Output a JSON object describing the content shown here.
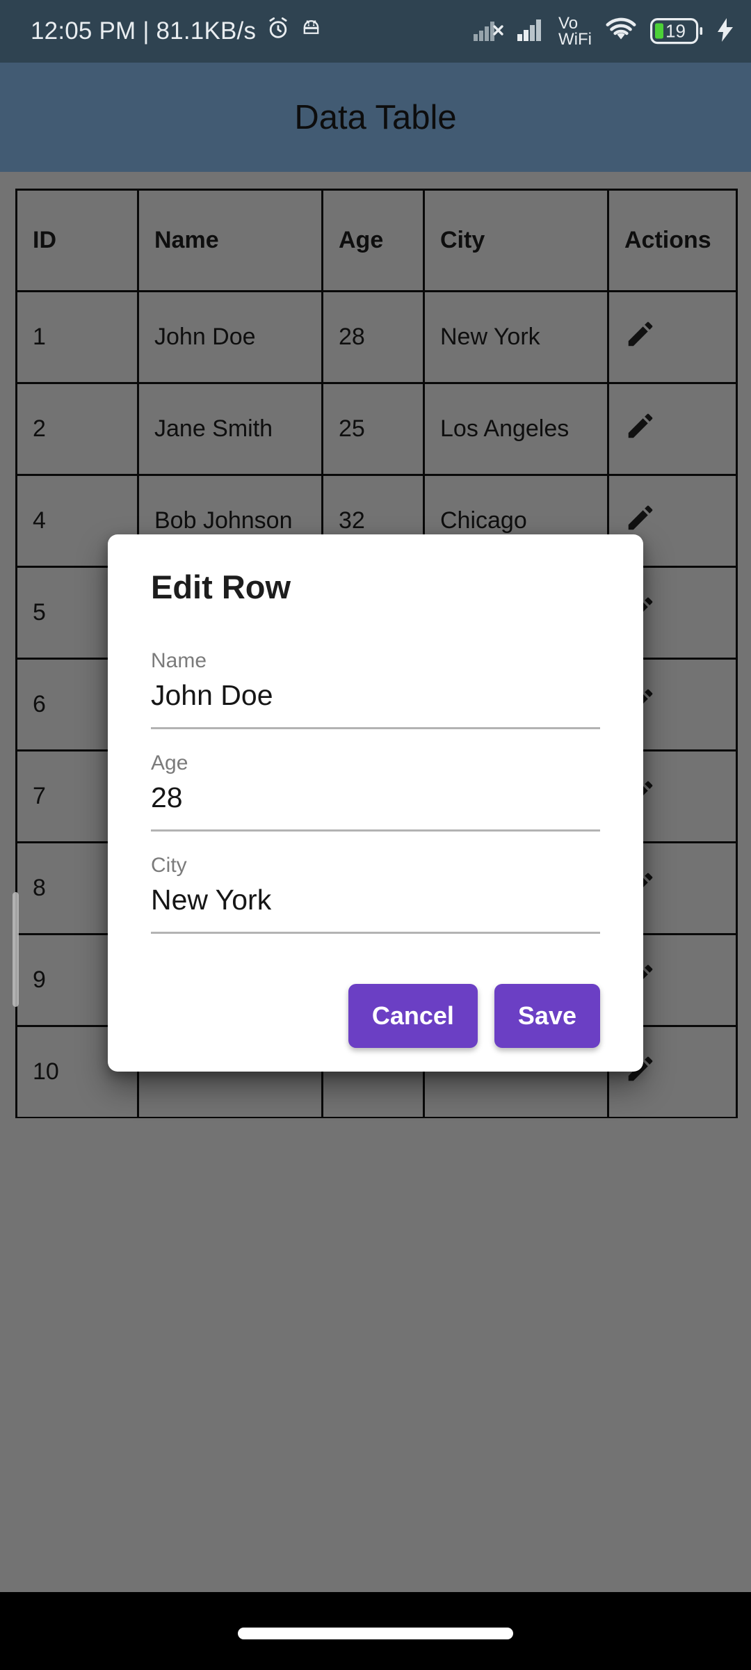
{
  "status_bar": {
    "time_and_net": "12:05 PM | 81.1KB/s",
    "alarm_icon": "alarm-icon",
    "android_debug_icon": "android-head-icon",
    "sim1_icon": "signal-no-service-icon",
    "sim2_icon": "signal-bars-icon",
    "vowifi_line1": "Vo",
    "vowifi_line2": "WiFi",
    "wifi_icon": "wifi-icon",
    "battery_level": "19",
    "charging_icon": "charging-bolt-icon",
    "bg_color": "#2f4351"
  },
  "app_bar": {
    "title": "Data Table",
    "bg_color": "#425b73",
    "title_color": "#0d0d0d"
  },
  "table": {
    "columns": [
      "ID",
      "Name",
      "Age",
      "City",
      "Actions"
    ],
    "action_icon": "pencil-edit-icon",
    "rows": [
      {
        "id": "1",
        "name": "John Doe",
        "age": "28",
        "city": "New York"
      },
      {
        "id": "2",
        "name": "Jane Smith",
        "age": "25",
        "city": "Los Angeles"
      },
      {
        "id": "4",
        "name": "Bob Johnson",
        "age": "32",
        "city": "Chicago"
      },
      {
        "id": "5",
        "name": "",
        "age": "",
        "city": ""
      },
      {
        "id": "6",
        "name": "",
        "age": "",
        "city": ""
      },
      {
        "id": "7",
        "name": "",
        "age": "",
        "city": ""
      },
      {
        "id": "8",
        "name": "",
        "age": "",
        "city": ""
      },
      {
        "id": "9",
        "name": "",
        "age": "",
        "city": ""
      },
      {
        "id": "10",
        "name": "",
        "age": "",
        "city": ""
      }
    ]
  },
  "dialog": {
    "title": "Edit Row",
    "fields": [
      {
        "label": "Name",
        "value": "John Doe"
      },
      {
        "label": "Age",
        "value": "28"
      },
      {
        "label": "City",
        "value": "New York"
      }
    ],
    "cancel_label": "Cancel",
    "save_label": "Save",
    "button_color": "#6b3fc4"
  },
  "nav_bar": {
    "gesture_pill": "home-gesture-pill"
  }
}
